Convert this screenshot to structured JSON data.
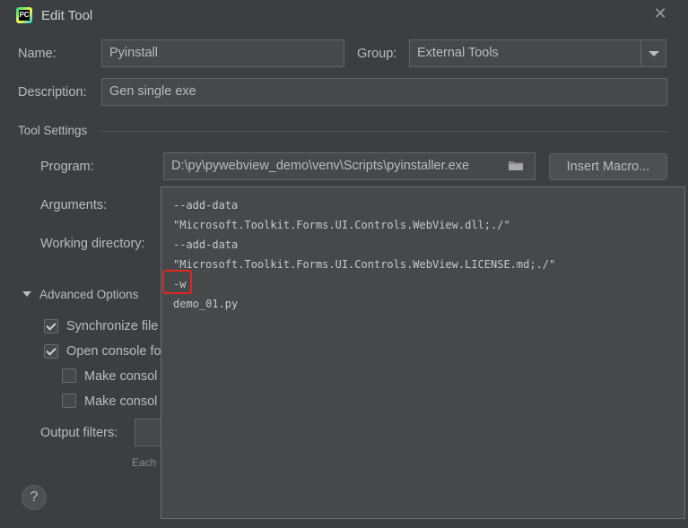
{
  "window": {
    "title": "Edit Tool",
    "close_glyph": "✕",
    "icon_text": "PC"
  },
  "form": {
    "name_label": "Name:",
    "name_value": "Pyinstall",
    "group_label": "Group:",
    "group_value": "External Tools",
    "description_label": "Description:",
    "description_value": "Gen single exe"
  },
  "tool_settings": {
    "header": "Tool Settings",
    "program_label": "Program:",
    "program_value": "D:\\py\\pywebview_demo\\venv\\Scripts\\pyinstaller.exe",
    "insert_macro_label": "Insert Macro...",
    "arguments_label": "Arguments:",
    "working_dir_label": "Working directory:"
  },
  "advanced": {
    "header": "Advanced Options",
    "sync_label": "Synchronize file",
    "sync_checked": true,
    "open_console_label": "Open console fo",
    "open_console_checked": true,
    "make_console_1_label": "Make consol",
    "make_console_2_label": "Make consol",
    "output_filters_label": "Output filters:",
    "each_hint": "Each"
  },
  "help": {
    "glyph": "?"
  },
  "arguments_popup": {
    "lines": [
      "--add-data",
      "\"Microsoft.Toolkit.Forms.UI.Controls.WebView.dll;./\"",
      "--add-data",
      "\"Microsoft.Toolkit.Forms.UI.Controls.WebView.LICENSE.md;./\"",
      "-w",
      "demo_01.py"
    ]
  }
}
